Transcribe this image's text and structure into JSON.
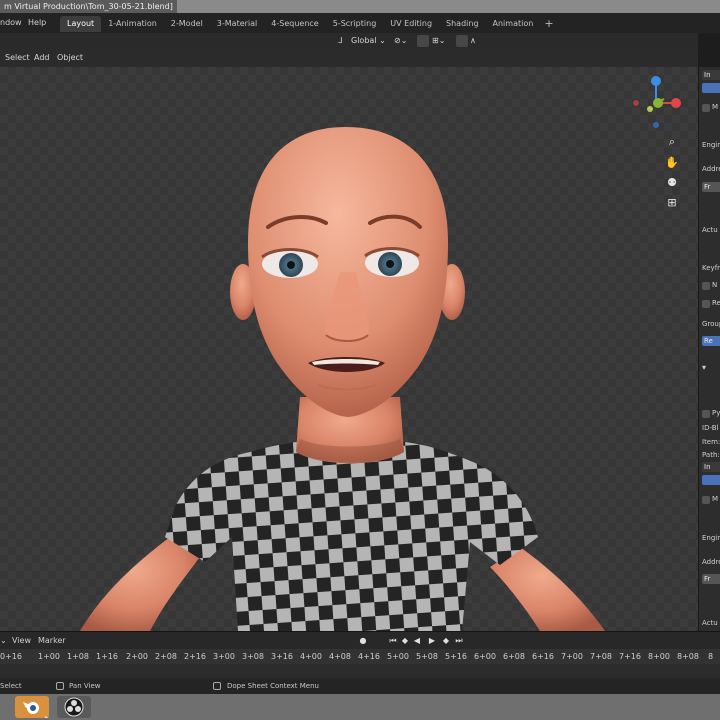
{
  "window": {
    "title": "m Virtual Production\\Tom_30-05-21.blend]"
  },
  "menubar": {
    "window": "ndow",
    "help": "Help"
  },
  "workspace_tabs": [
    {
      "label": "Layout",
      "active": true
    },
    {
      "label": "1-Animation",
      "active": false
    },
    {
      "label": "2-Model",
      "active": false
    },
    {
      "label": "3-Material",
      "active": false
    },
    {
      "label": "4-Sequence",
      "active": false
    },
    {
      "label": "5-Scripting",
      "active": false
    },
    {
      "label": "UV Editing",
      "active": false
    },
    {
      "label": "Shading",
      "active": false
    },
    {
      "label": "Animation",
      "active": false
    }
  ],
  "add_workspace": "+",
  "header": {
    "orientation": "Global"
  },
  "viewport_menu": {
    "select": "Select",
    "add": "Add",
    "object": "Object"
  },
  "gizmo": {
    "x_color": "#e04848",
    "y_color": "#86b434",
    "z_color": "#3b8ee8"
  },
  "nav_icons": [
    "zoom-icon",
    "pan-hand-icon",
    "camera-icon",
    "grid-icon"
  ],
  "properties_panel": {
    "tab_label": "In",
    "m1": "M",
    "engine1": "Engin",
    "address1": "Addre",
    "field1": "Fr",
    "actual1": "Actu",
    "keyframes": "Keyfr",
    "n": "N",
    "re": "Re",
    "group": "Group",
    "group_btn": "Re",
    "py": "Py",
    "id_block": "ID-Bl",
    "item": "Item:",
    "path": "Path:",
    "tab2": "In",
    "m2": "M",
    "engine2": "Engin",
    "address2": "Addre",
    "field2": "Fr",
    "actual2": "Actu"
  },
  "timeline": {
    "menu_view": "View",
    "menu_marker": "Marker",
    "ruler": [
      "0+16",
      "1+00",
      "1+08",
      "1+16",
      "2+00",
      "2+08",
      "2+16",
      "3+00",
      "3+08",
      "3+16",
      "4+00",
      "4+08",
      "4+16",
      "5+00",
      "5+08",
      "5+16",
      "6+00",
      "6+08",
      "6+16",
      "7+00",
      "7+08",
      "7+16",
      "8+00",
      "8+08"
    ],
    "ruler_first": "0",
    "ruler_last": "8"
  },
  "statusbar": {
    "select": "Select",
    "pan_view": "Pan View",
    "context_menu": "Dope Sheet Context Menu"
  }
}
